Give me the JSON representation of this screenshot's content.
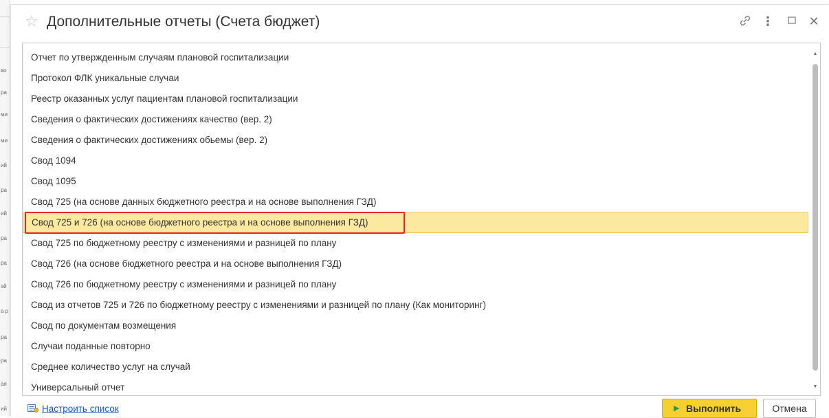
{
  "window": {
    "title": "Дополнительные отчеты (Счета бюджет)"
  },
  "titlebar_icons": {
    "favorite": "star-icon",
    "link": "link-icon",
    "more": "more-icon",
    "maximize": "maximize-icon",
    "close": "close-icon"
  },
  "list": {
    "items": [
      "Отчет по утвержденным случаям плановой госпитализации",
      "Протокол ФЛК уникальные случаи",
      "Реестр оказанных услуг пациентам плановой госпитализации",
      "Сведения о фактических достижениях качество (вер. 2)",
      "Сведения о фактических достижениях обьемы (вер. 2)",
      "Свод 1094",
      "Свод 1095",
      "Свод 725 (на основе данных бюджетного реестра и на основе выполнения ГЗД)",
      "Свод 725 и 726 (на основе бюджетного реестра и на основе выполнения ГЗД)",
      "Свод 725 по бюджетному реестру с изменениями и разницей по плану",
      "Свод 726 (на основе бюджетного реестра и на основе выполнения ГЗД)",
      "Свод 726 по бюджетному реестру с изменениями и разницей по плану",
      "Свод из отчетов 725 и 726 по бюджетному реестру с изменениями и разницей по плану (Как мониторинг)",
      "Свод по документам возмещения",
      "Случаи поданные повторно",
      "Среднее количество услуг на случай",
      "Универсальный отчет"
    ],
    "selected_index": 8
  },
  "footer": {
    "configure_link": "Настроить список",
    "run_button": "Выполнить",
    "cancel_button": "Отмена"
  },
  "colors": {
    "selected_row": "#fbe9a0",
    "highlight_outline": "#e3242b",
    "run_button": "#f6cf30",
    "link": "#2055b8"
  },
  "background_fragments": [
    "во",
    "ра",
    "ми",
    "ми",
    "ий",
    "ра",
    "ий",
    "ра",
    "ра",
    "эй",
    "а р",
    "ра",
    "ра",
    "ая",
    "ий"
  ]
}
